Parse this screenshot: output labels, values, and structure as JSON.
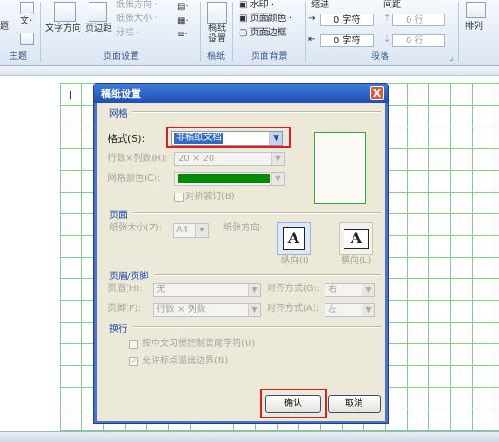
{
  "ribbon": {
    "left_items": [
      "题",
      "文·",
      "主题"
    ],
    "text_direction": "文字方向",
    "page_margins": "页边距",
    "orientation": "纸张方向 ·",
    "paper_size": "纸张大小 ·",
    "columns": "分栏 ·",
    "page_setup_group": "页面设置",
    "manuscript_button": "稿纸设置",
    "manuscript_group": "稿纸",
    "watermark": "水印 ·",
    "page_color": "页面颜色 ·",
    "page_border": "页面边框",
    "page_background_group": "页面背景",
    "indent_label": "缩进",
    "spacing_label": "间距",
    "indent_left": "0 字符",
    "indent_right": "0 字符",
    "spacing_before": "0 行",
    "spacing_after": "0 行",
    "paragraph_group": "段落",
    "arrange": "排列"
  },
  "dialog": {
    "title": "稿纸设置",
    "close": "X",
    "grid_section": "网格",
    "format_label": "格式(S):",
    "format_value": "非稿纸文档",
    "rows_cols_label": "行数×列数(R):",
    "rows_cols_value": "20 × 20",
    "grid_color_label": "网格颜色(C):",
    "fold_label": "对折装订(B)",
    "page_section": "页面",
    "paper_size_label": "纸张大小(Z):",
    "paper_size_value": "A4",
    "orientation_label": "纸张方向:",
    "portrait_label": "纵向(I)",
    "landscape_label": "横向(L)",
    "header_footer_section": "页眉/页脚",
    "header_label": "页眉(H):",
    "header_value": "无",
    "header_align_label": "对齐方式(G):",
    "header_align_value": "右",
    "footer_label": "页脚(F):",
    "footer_value": "行数 × 列数",
    "footer_align_label": "对齐方式(A):",
    "footer_align_value": "左",
    "wrap_section": "换行",
    "wrap_opt1": "按中文习惯控制首尾字符(U)",
    "wrap_opt2": "允许标点溢出边界(N)",
    "ok": "确认",
    "cancel": "取消"
  },
  "colors": {
    "grid_color": "#008c00",
    "grid_line": "#7fcf8b",
    "highlight": "#e01d1d"
  }
}
